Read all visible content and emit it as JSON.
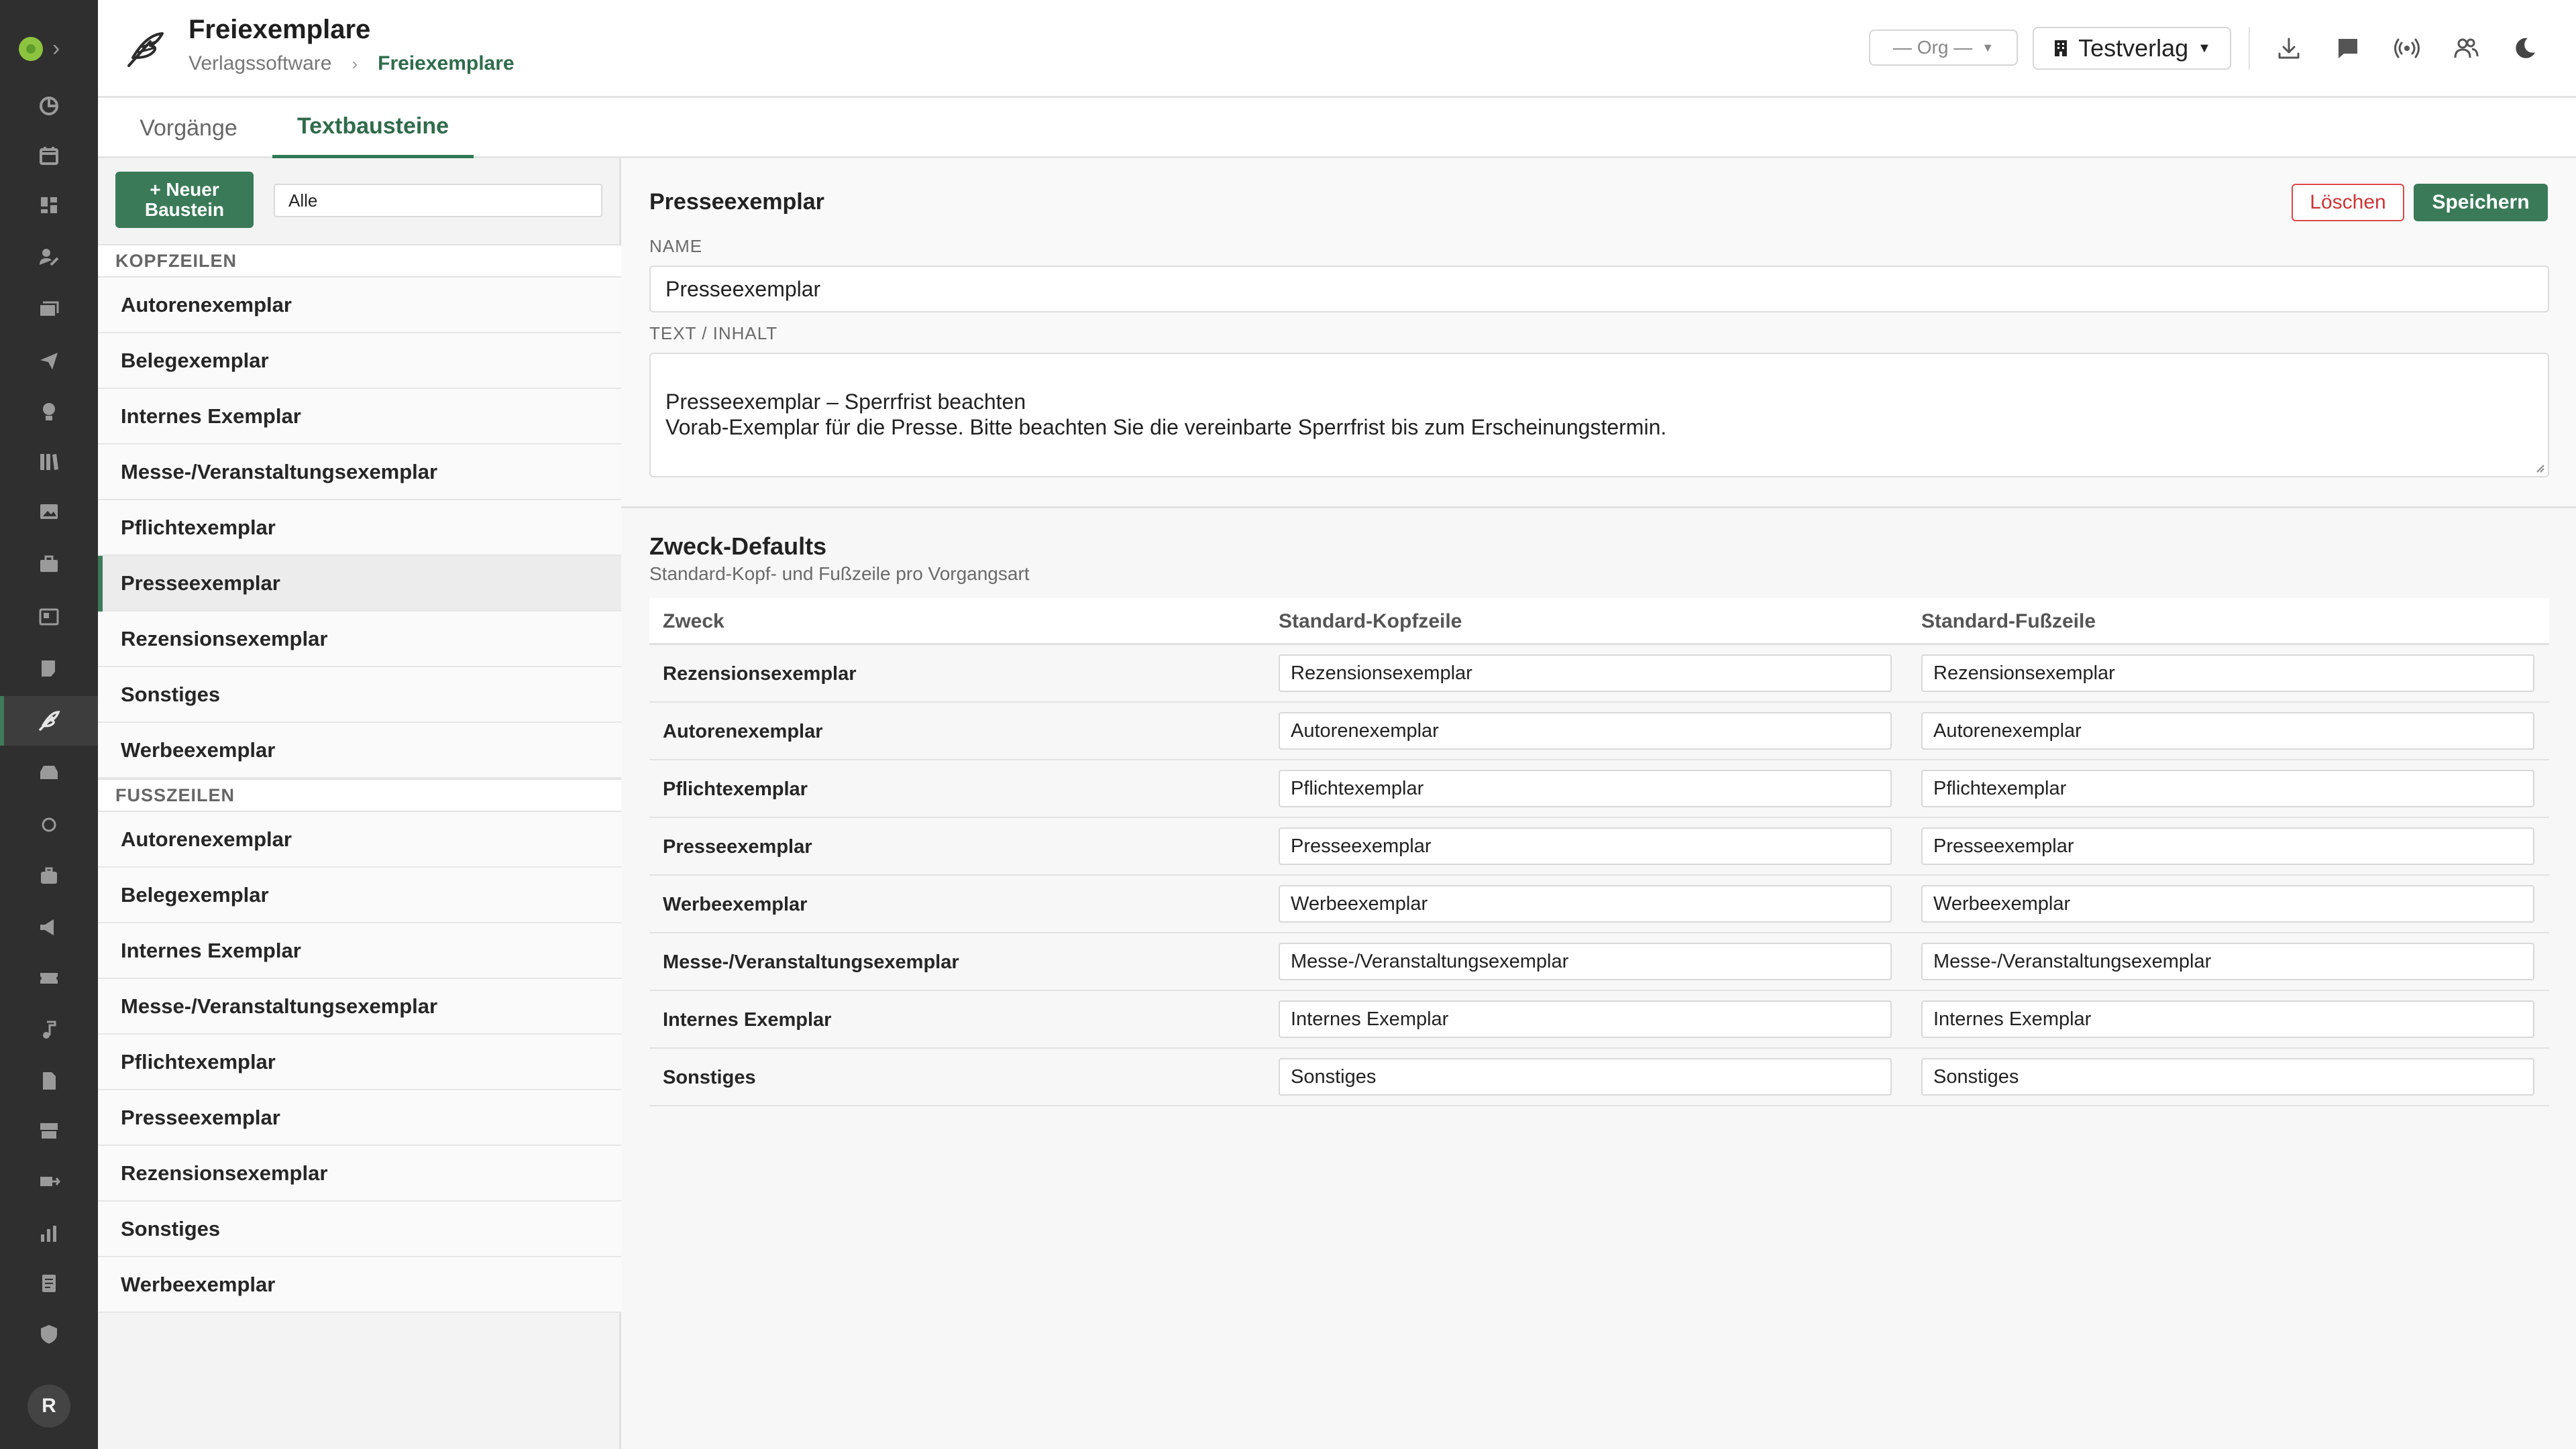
{
  "header": {
    "title": "Freiexemplare",
    "breadcrumb": [
      "Verlagssoftware",
      "Freiexemplare"
    ],
    "breadcrumb_sep": "›",
    "org_select": "— Org —",
    "verlag_select": "Testverlag",
    "icons": [
      "download-icon",
      "chat-icon",
      "broadcast-icon",
      "users-icon",
      "moon-icon"
    ]
  },
  "sidebar": {
    "expand_glyph": "›",
    "user_initial": "R",
    "icons": [
      "pie-chart-icon",
      "calendar-icon",
      "dashboard-icon",
      "user-edit-icon",
      "mail-stack-icon",
      "paper-plane-icon",
      "lightbulb-icon",
      "library-icon",
      "image-icon",
      "briefcase-icon",
      "contact-card-icon",
      "cart-icon",
      "feather-icon",
      "inbox-icon",
      "circle-icon",
      "suitcase-icon",
      "megaphone-icon",
      "ticket-icon",
      "music-note-icon",
      "file-icon",
      "store-icon",
      "shipping-icon",
      "bar-chart-icon",
      "document-icon",
      "shield-icon"
    ],
    "active_index": 12
  },
  "tabs": [
    {
      "label": "Vorgänge"
    },
    {
      "label": "Textbausteine"
    }
  ],
  "list": {
    "new_button": "+ Neuer Baustein",
    "filter_value": "Alle",
    "groups": [
      {
        "label": "KOPFZEILEN",
        "items": [
          "Autorenexemplar",
          "Belegexemplar",
          "Internes Exemplar",
          "Messe-/Veranstaltungsexemplar",
          "Pflichtexemplar",
          "Presseexemplar",
          "Rezensionsexemplar",
          "Sonstiges",
          "Werbeexemplar"
        ]
      },
      {
        "label": "FUSSZEILEN",
        "items": [
          "Autorenexemplar",
          "Belegexemplar",
          "Internes Exemplar",
          "Messe-/Veranstaltungsexemplar",
          "Pflichtexemplar",
          "Presseexemplar",
          "Rezensionsexemplar",
          "Sonstiges",
          "Werbeexemplar"
        ]
      }
    ],
    "selected": "Presseexemplar"
  },
  "editor": {
    "title": "Presseexemplar",
    "delete_label": "Löschen",
    "save_label": "Speichern",
    "name_label": "NAME",
    "name_value": "Presseexemplar",
    "text_label": "TEXT / INHALT",
    "text_value": "Presseexemplar – Sperrfrist beachten\nVorab-Exemplar für die Presse. Bitte beachten Sie die vereinbarte Sperrfrist bis zum Erscheinungstermin."
  },
  "defaults": {
    "title": "Zweck-Defaults",
    "subtitle": "Standard-Kopf- und Fußzeile pro Vorgangsart",
    "columns": [
      "Zweck",
      "Standard-Kopfzeile",
      "Standard-Fußzeile"
    ],
    "rows": [
      {
        "zweck": "Rezensionsexemplar",
        "kopf": "Rezensionsexemplar",
        "fuss": "Rezensionsexemplar"
      },
      {
        "zweck": "Autorenexemplar",
        "kopf": "Autorenexemplar",
        "fuss": "Autorenexemplar"
      },
      {
        "zweck": "Pflichtexemplar",
        "kopf": "Pflichtexemplar",
        "fuss": "Pflichtexemplar"
      },
      {
        "zweck": "Presseexemplar",
        "kopf": "Presseexemplar",
        "fuss": "Presseexemplar"
      },
      {
        "zweck": "Werbeexemplar",
        "kopf": "Werbeexemplar",
        "fuss": "Werbeexemplar"
      },
      {
        "zweck": "Messe-/Veranstaltungsexemplar",
        "kopf": "Messe-/Veranstaltungsexemplar",
        "fuss": "Messe-/Veranstaltungsexemplar"
      },
      {
        "zweck": "Internes Exemplar",
        "kopf": "Internes Exemplar",
        "fuss": "Internes Exemplar"
      },
      {
        "zweck": "Sonstiges",
        "kopf": "Sonstiges",
        "fuss": "Sonstiges"
      }
    ]
  },
  "colors": {
    "accent": "#3a7a58",
    "danger": "#c93636",
    "rail": "#2f2f2f"
  }
}
